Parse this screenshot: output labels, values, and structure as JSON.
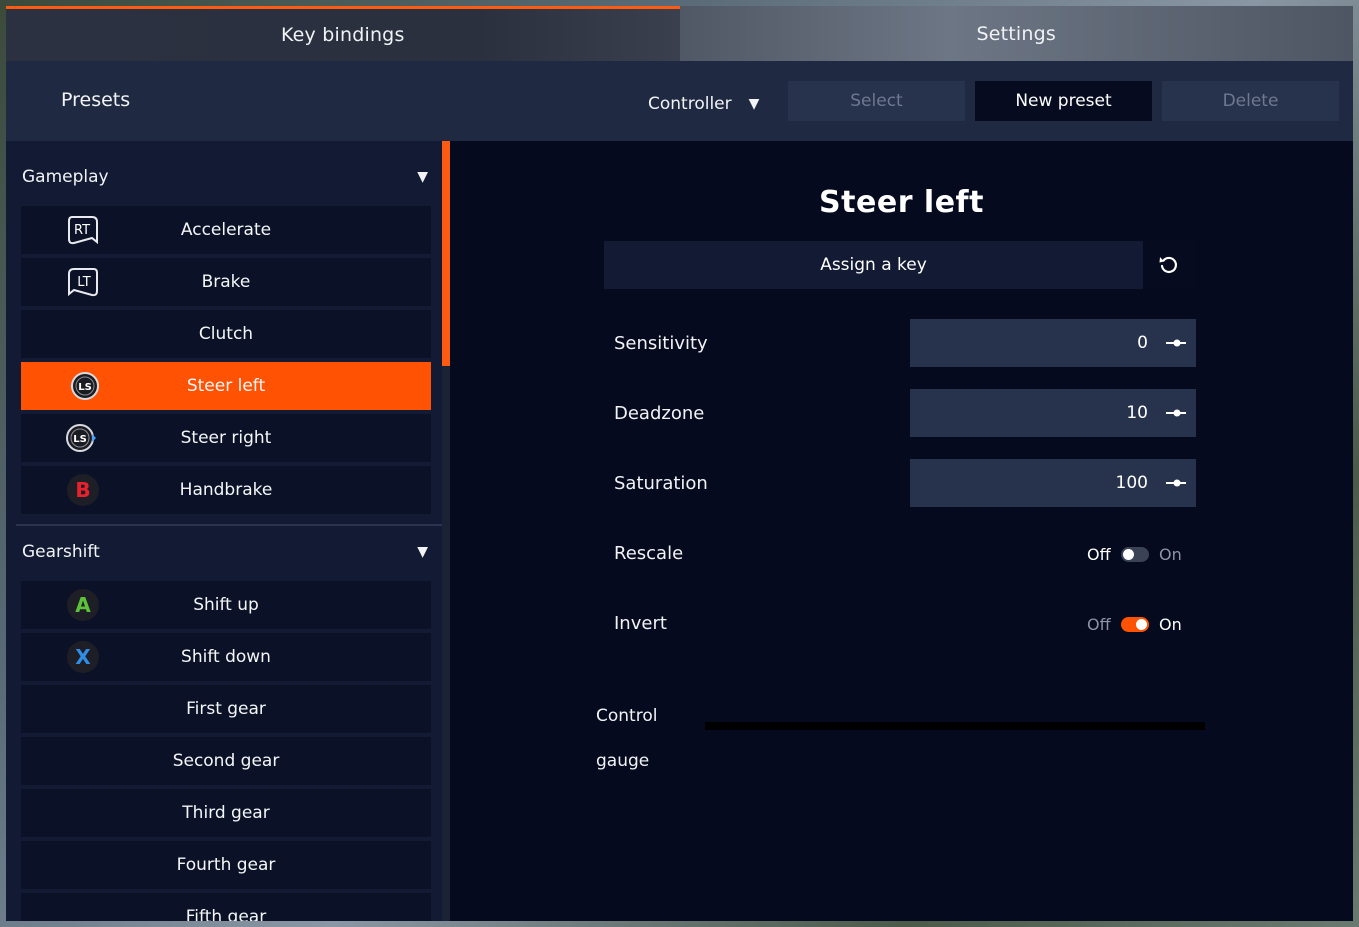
{
  "tabs": [
    {
      "label": "Key bindings",
      "active": true
    },
    {
      "label": "Settings",
      "active": false
    }
  ],
  "presets": {
    "title": "Presets",
    "controller_label": "Controller",
    "select_label": "Select",
    "new_preset_label": "New preset",
    "delete_label": "Delete"
  },
  "groups": {
    "gameplay": {
      "label": "Gameplay",
      "items": [
        {
          "label": "Accelerate",
          "icon": "rt-trigger-icon"
        },
        {
          "label": "Brake",
          "icon": "lt-trigger-icon"
        },
        {
          "label": "Clutch",
          "icon": ""
        },
        {
          "label": "Steer left",
          "icon": "left-stick-left-icon",
          "selected": true
        },
        {
          "label": "Steer right",
          "icon": "left-stick-right-icon"
        },
        {
          "label": "Handbrake",
          "icon": "b-button-icon"
        }
      ]
    },
    "gearshift": {
      "label": "Gearshift",
      "items": [
        {
          "label": "Shift up",
          "icon": "a-button-icon"
        },
        {
          "label": "Shift down",
          "icon": "x-button-icon"
        },
        {
          "label": "First gear",
          "icon": ""
        },
        {
          "label": "Second gear",
          "icon": ""
        },
        {
          "label": "Third gear",
          "icon": ""
        },
        {
          "label": "Fourth gear",
          "icon": ""
        },
        {
          "label": "Fifth gear",
          "icon": ""
        }
      ]
    }
  },
  "detail": {
    "title": "Steer left",
    "assign_label": "Assign a key",
    "sensitivity": {
      "label": "Sensitivity",
      "value": "0"
    },
    "deadzone": {
      "label": "Deadzone",
      "value": "10"
    },
    "saturation": {
      "label": "Saturation",
      "value": "100"
    },
    "rescale": {
      "label": "Rescale",
      "off": "Off",
      "on": "On",
      "state": false
    },
    "invert": {
      "label": "Invert",
      "off": "Off",
      "on": "On",
      "state": true
    },
    "gauge_label_1": "Control",
    "gauge_label_2": "gauge"
  },
  "colors": {
    "accent": "#ff5203",
    "panel": "#121a34",
    "background": "#060b20"
  }
}
